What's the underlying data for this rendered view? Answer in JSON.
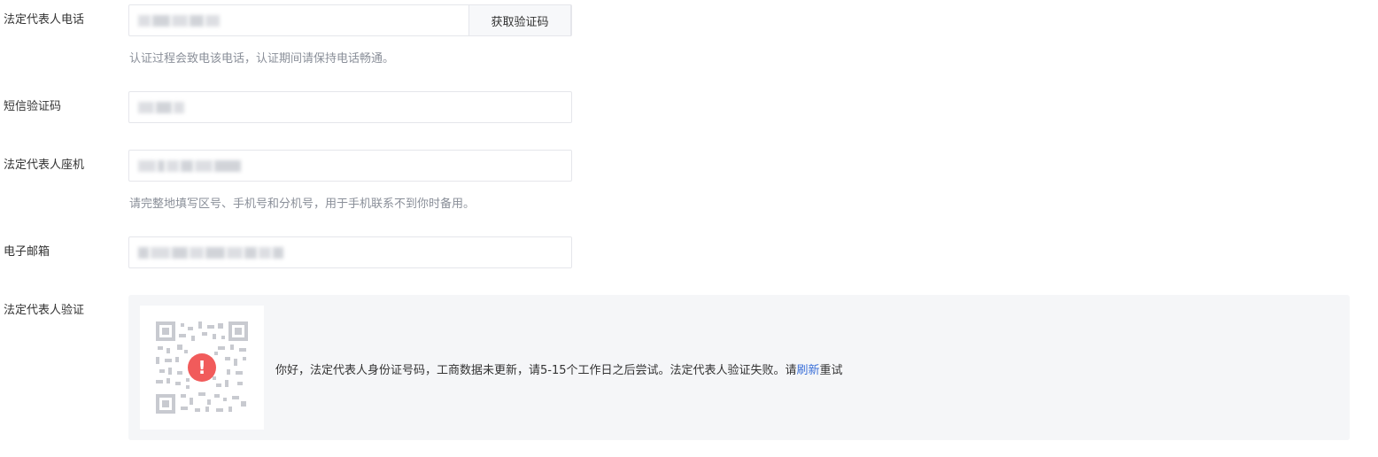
{
  "form": {
    "phone": {
      "label": "法定代表人电话",
      "button_label": "获取验证码",
      "hint": "认证过程会致电该电话，认证期间请保持电话畅通。"
    },
    "sms_code": {
      "label": "短信验证码"
    },
    "landline": {
      "label": "法定代表人座机",
      "hint": "请完整地填写区号、手机号和分机号，用于手机联系不到你时备用。"
    },
    "email": {
      "label": "电子邮箱"
    },
    "legal_verify": {
      "label": "法定代表人验证",
      "status_icon": "alert-exclamation-icon",
      "message_before": "你好，法定代表人身份证号码，工商数据未更新，请5-15个工作日之后尝试。法定代表人验证失败。请",
      "refresh_link": "刷新",
      "message_after": "重试"
    }
  },
  "colors": {
    "error": "#f15b5b",
    "link": "#3a6fd8",
    "hint": "#8a8f99",
    "panel_bg": "#f5f6f8"
  }
}
